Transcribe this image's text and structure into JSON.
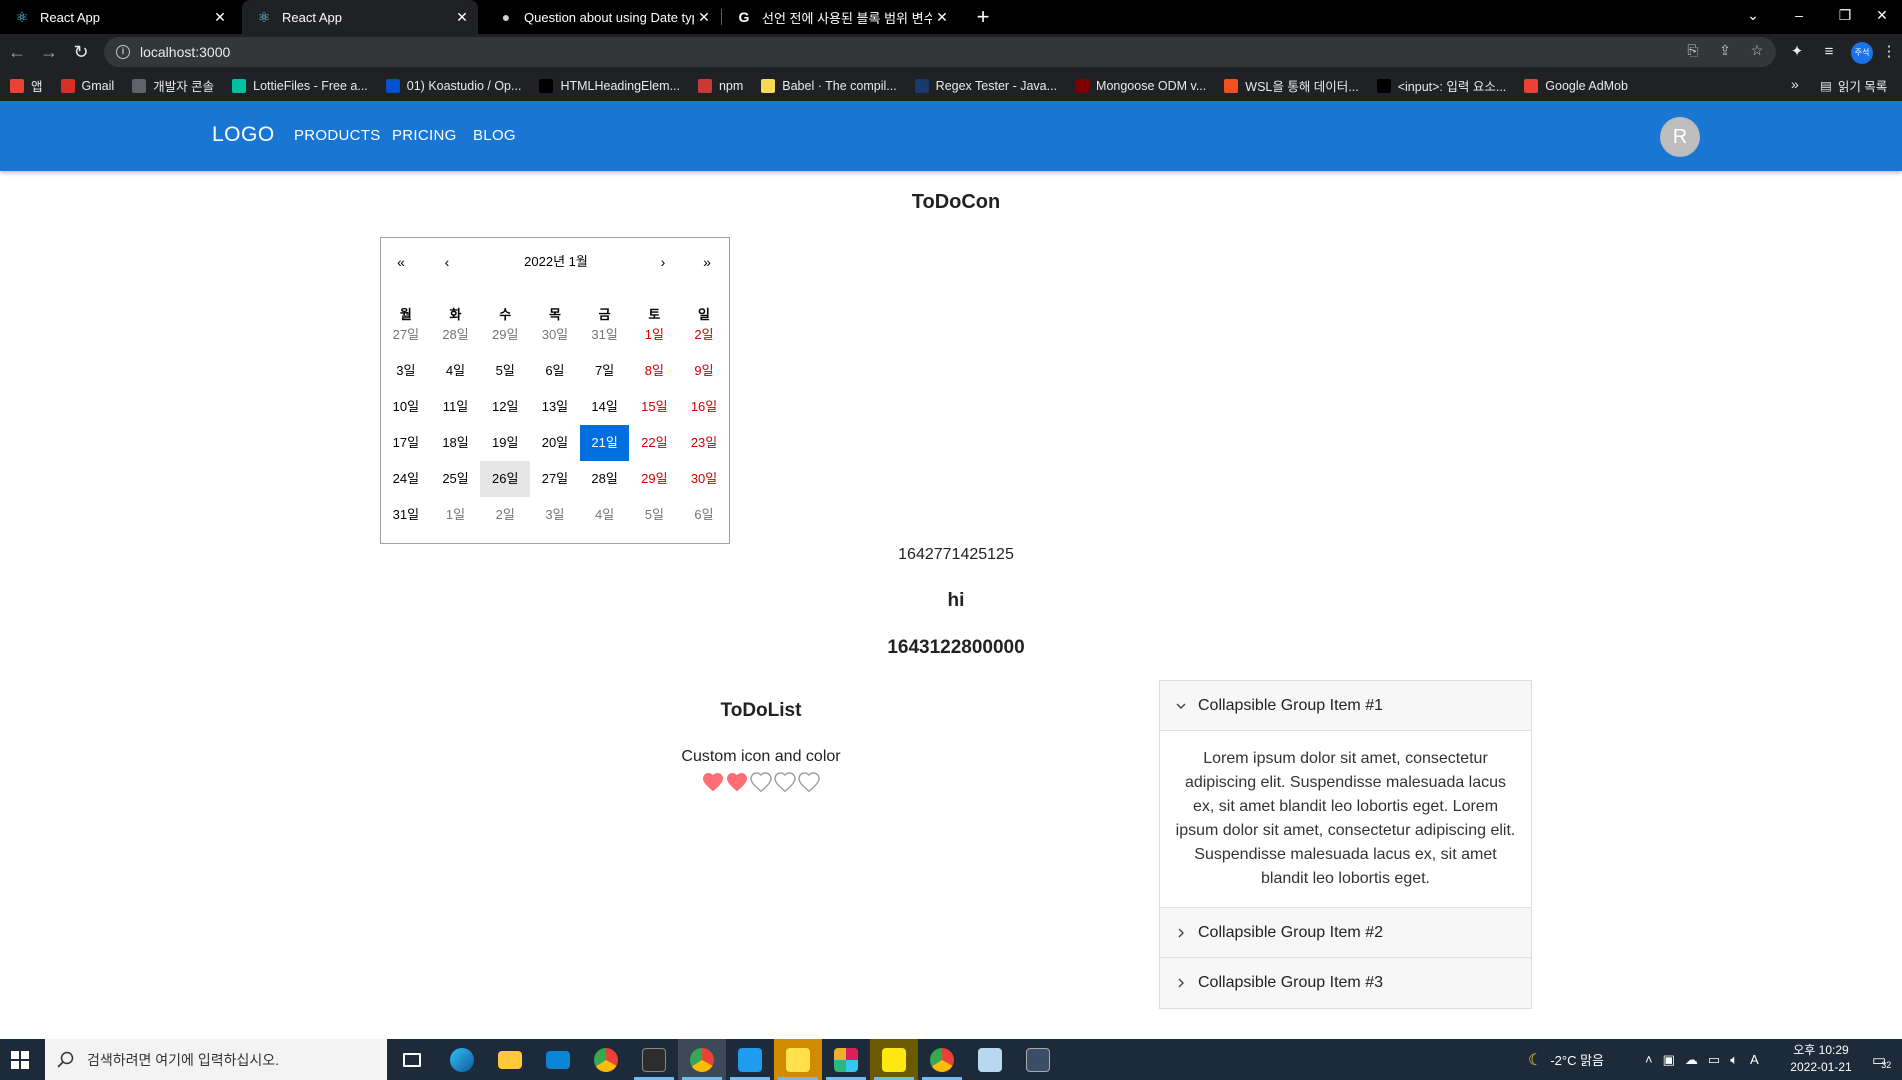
{
  "browser": {
    "tabs": [
      {
        "title": "React App",
        "active": false
      },
      {
        "title": "React App",
        "active": true
      },
      {
        "title": "Question about using Date type",
        "active": false
      },
      {
        "title": "선언 전에 사용된 블록 범위 변수",
        "active": false
      }
    ],
    "url": "localhost:3000",
    "profile_label": "주석",
    "bookmarks": [
      {
        "label": "앱",
        "color": "#ea4335"
      },
      {
        "label": "Gmail",
        "color": "#d93025"
      },
      {
        "label": "개발자 콘솔",
        "color": "#5f6368"
      },
      {
        "label": "LottieFiles - Free a...",
        "color": "#00c1a2"
      },
      {
        "label": "01) Koastudio / Op...",
        "color": "#0052cc"
      },
      {
        "label": "HTMLHeadingElem...",
        "color": "#000000"
      },
      {
        "label": "npm",
        "color": "#cb3837"
      },
      {
        "label": "Babel · The compil...",
        "color": "#f5da55"
      },
      {
        "label": "Regex Tester - Java...",
        "color": "#1a3a6b"
      },
      {
        "label": "Mongoose ODM v...",
        "color": "#800000"
      },
      {
        "label": "WSL을 통해 데이터...",
        "color": "#f25022"
      },
      {
        "label": "<input>: 입력 요소...",
        "color": "#000000"
      },
      {
        "label": "Google AdMob",
        "color": "#ea4335"
      }
    ],
    "bookmarks_more": "»",
    "reading_list": "읽기 목록"
  },
  "appbar": {
    "logo": "LOGO",
    "links": [
      "PRODUCTS",
      "PRICING",
      "BLOG"
    ],
    "avatar_letter": "R",
    "color": "#1976d2"
  },
  "todocon": {
    "title": "ToDoCon",
    "calendar": {
      "nav_first": "«",
      "nav_prev": "‹",
      "label": "2022년 1월",
      "nav_next": "›",
      "nav_last": "»",
      "weekdays": [
        "월",
        "화",
        "수",
        "목",
        "금",
        "토",
        "일"
      ],
      "days": [
        [
          "27일",
          "28일",
          "29일",
          "30일",
          "31일",
          "1일",
          "2일"
        ],
        [
          "3일",
          "4일",
          "5일",
          "6일",
          "7일",
          "8일",
          "9일"
        ],
        [
          "10일",
          "11일",
          "12일",
          "13일",
          "14일",
          "15일",
          "16일"
        ],
        [
          "17일",
          "18일",
          "19일",
          "20일",
          "21일",
          "22일",
          "23일"
        ],
        [
          "24일",
          "25일",
          "26일",
          "27일",
          "28일",
          "29일",
          "30일"
        ],
        [
          "31일",
          "1일",
          "2일",
          "3일",
          "4일",
          "5일",
          "6일"
        ]
      ],
      "selected_color": "#006edc",
      "weekend_color": "#d10000"
    },
    "timestamp": "1642771425125",
    "greeting": "hi",
    "selected_timestamp": "1643122800000"
  },
  "todolist": {
    "title": "ToDoList",
    "rating_label": "Custom icon and color",
    "rating_value": 2,
    "rating_max": 5,
    "heart_color": "#ff6d75"
  },
  "accordion": {
    "items": [
      {
        "title": "Collapsible Group Item #1",
        "expanded": true,
        "body": "Lorem ipsum dolor sit amet, consectetur adipiscing elit. Suspendisse malesuada lacus ex, sit amet blandit leo lobortis eget. Lorem ipsum dolor sit amet, consectetur adipiscing elit. Suspendisse malesuada lacus ex, sit amet blandit leo lobortis eget."
      },
      {
        "title": "Collapsible Group Item #2",
        "expanded": false
      },
      {
        "title": "Collapsible Group Item #3",
        "expanded": false
      }
    ]
  },
  "taskbar": {
    "search_placeholder": "검색하려면 여기에 입력하십시오.",
    "weather": "-2°C 맑음",
    "time": "오후 10:29",
    "date": "2022-01-21",
    "notification_count": "32",
    "ime": "A"
  }
}
